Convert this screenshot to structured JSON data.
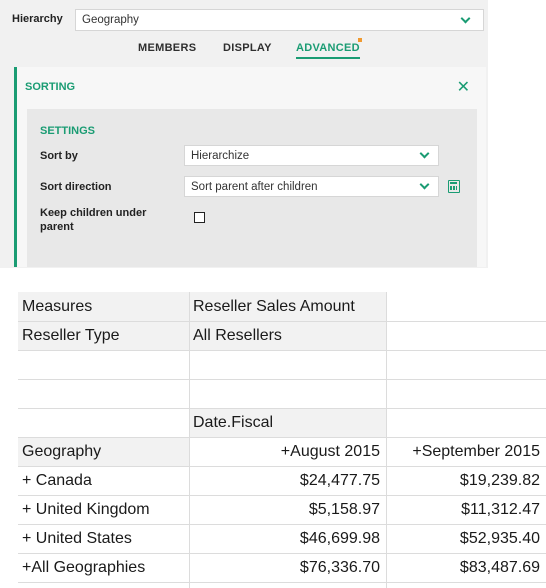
{
  "hierarchy": {
    "label": "Hierarchy",
    "value": "Geography"
  },
  "tabs": {
    "members": "MEMBERS",
    "display": "DISPLAY",
    "advanced": "ADVANCED"
  },
  "sorting": {
    "title": "SORTING",
    "close_icon": "close-icon",
    "settings": {
      "title": "SETTINGS",
      "sort_by_label": "Sort by",
      "sort_by_value": "Hierarchize",
      "sort_direction_label": "Sort direction",
      "sort_direction_value": "Sort parent after children",
      "keep_children_label": "Keep children under parent",
      "keep_children_checked": false
    }
  },
  "sheet": {
    "measures_label": "Measures",
    "measures_value": "Reseller Sales Amount",
    "reseller_type_label": "Reseller Type",
    "reseller_type_value": "All Resellers",
    "column_dimension": "Date.Fiscal",
    "row_dimension": "Geography",
    "columns": [
      "+August 2015",
      "+September 2015"
    ],
    "rows": [
      {
        "label": "+  Canada",
        "values": [
          "$24,477.75",
          "$19,239.82"
        ]
      },
      {
        "label": "+  United Kingdom",
        "values": [
          "$5,158.97",
          "$11,312.47"
        ]
      },
      {
        "label": "+  United States",
        "values": [
          "$46,699.98",
          "$52,935.40"
        ]
      },
      {
        "label": "+All Geographies",
        "values": [
          "$76,336.70",
          "$83,487.69"
        ]
      }
    ]
  },
  "colors": {
    "accent": "#1a9c73",
    "indicator": "#f09a30"
  }
}
